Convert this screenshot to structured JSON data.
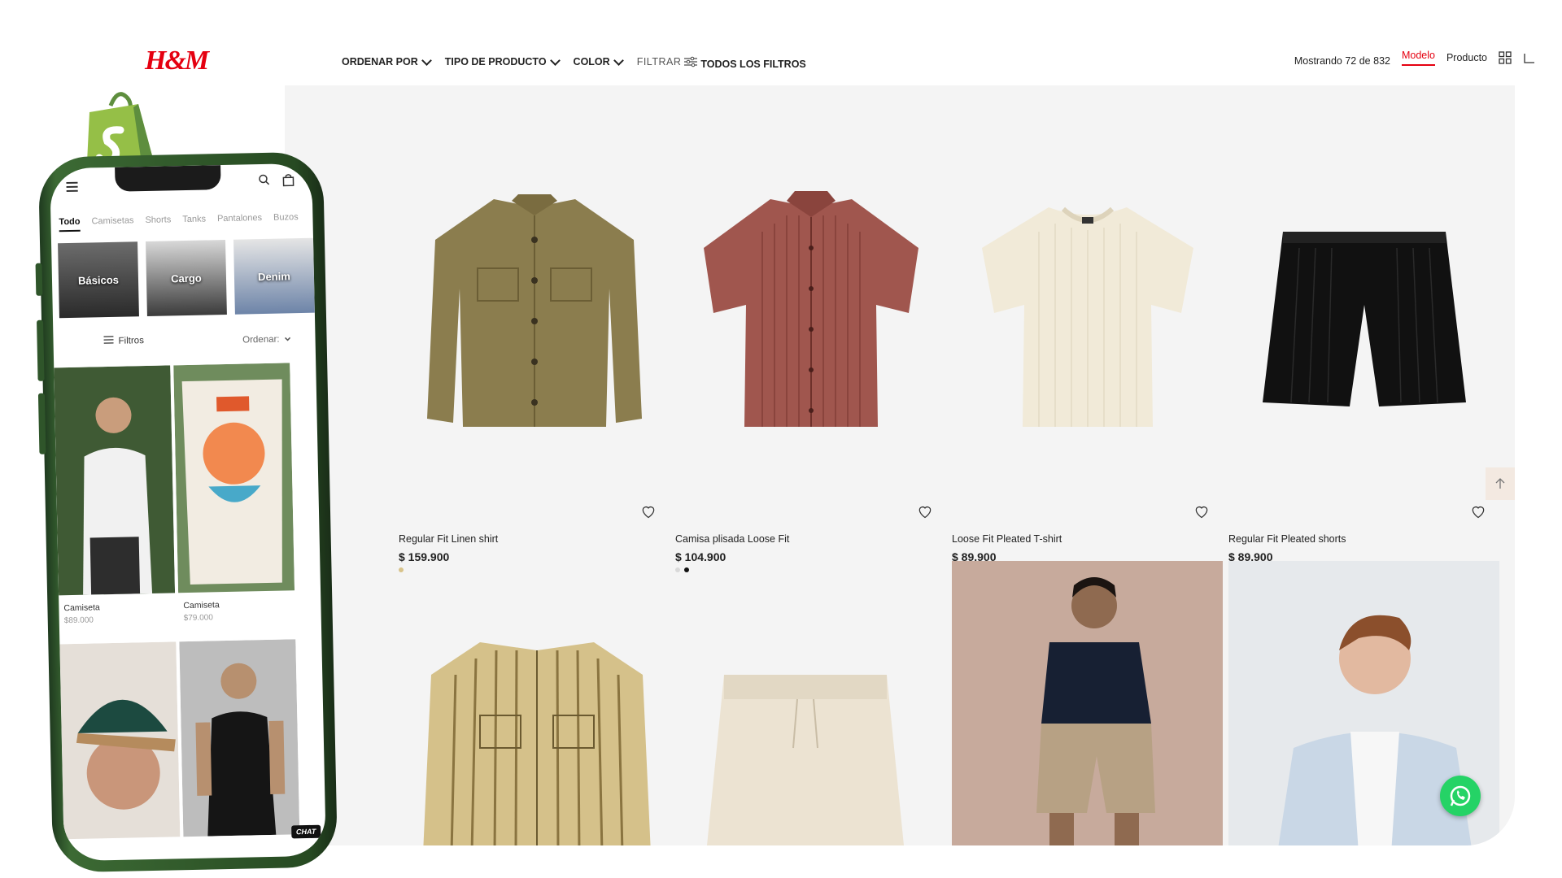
{
  "brand": {
    "logo_text": "H&M",
    "color": "#e50010"
  },
  "toolbar": {
    "sort_label": "ORDENAR POR",
    "type_label": "TIPO DE PRODUCTO",
    "color_label": "COLOR",
    "filter_label": "FILTRAR",
    "all_filters_label": "TODOS LOS FILTROS",
    "showing_text": "Mostrando 72 de 832",
    "view_model": "Modelo",
    "view_product": "Producto"
  },
  "products": [
    {
      "name": "Regular Fit Linen shirt",
      "price": "$ 159.900",
      "swatches": [
        "#d8c38a"
      ]
    },
    {
      "name": "Camisa plisada Loose Fit",
      "price": "$ 104.900",
      "swatches": [
        "#d9d9d9",
        "#111111"
      ]
    },
    {
      "name": "Loose Fit Pleated T-shirt",
      "price": "$ 89.900",
      "swatches": []
    },
    {
      "name": "Regular Fit Pleated shorts",
      "price": "$ 89.900",
      "swatches": []
    }
  ],
  "mobile": {
    "tabs": [
      "Todo",
      "Camisetas",
      "Shorts",
      "Tanks",
      "Pantalones",
      "Buzos"
    ],
    "categories": [
      "Básicos",
      "Cargo",
      "Denim"
    ],
    "filters_label": "Filtros",
    "order_label": "Ordenar:",
    "products": [
      {
        "name": "Camiseta",
        "price": "$89.000"
      },
      {
        "name": "Camiseta",
        "price": "$79.000"
      }
    ],
    "chat_label": "CHAT"
  },
  "colors": {
    "accent": "#e50010",
    "phone": "#2f552a",
    "shopify": "#95bf47",
    "whatsapp": "#25d366"
  }
}
